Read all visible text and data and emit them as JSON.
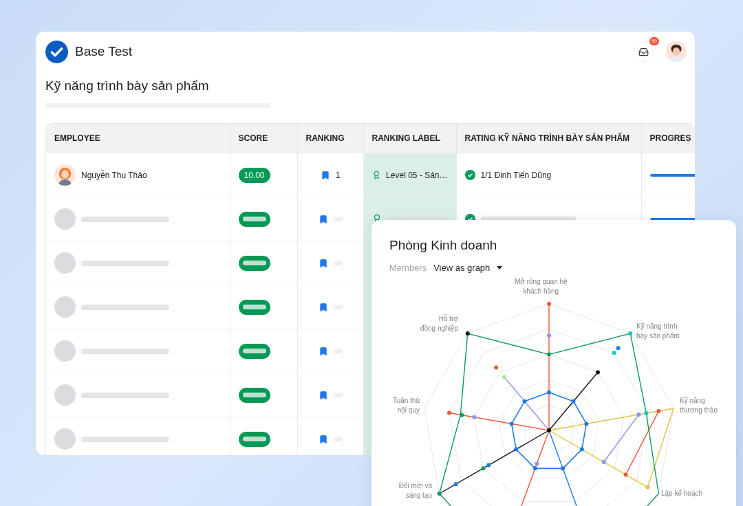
{
  "app": {
    "title": "Base Test",
    "notification_count": "99"
  },
  "page": {
    "title": "Kỹ năng trình bày sản phẩm"
  },
  "table": {
    "columns": [
      "EMPLOYEE",
      "SCORE",
      "RANKING",
      "RANKING LABEL",
      "RATING KỸ NĂNG TRÌNH BÀY SẢN PHẨM",
      "PROGRES"
    ],
    "rows": [
      {
        "kind": "employee",
        "name": "Nguyễn Thu Thảo",
        "score": "10.00",
        "rank": "1",
        "ranking_label": "Level 05 - Sán…",
        "rating": "1/1 Đinh Tiến Dũng",
        "level": 1
      },
      {
        "kind": "skeleton",
        "level": 1
      },
      {
        "kind": "skeleton_partial"
      },
      {
        "kind": "skeleton_partial"
      },
      {
        "kind": "skeleton_partial"
      },
      {
        "kind": "skeleton_partial"
      },
      {
        "kind": "skeleton_partial"
      }
    ]
  },
  "panel": {
    "title": "Phòng Kinh doanh",
    "filter_label": "Members",
    "view": "View as graph",
    "axis_labels": [
      "Mở rộng quan hệ\nkhách hàng",
      "Hỗ trợ\nđồng nghiệp",
      "Kỹ năng trình\nbày sản phẩm",
      "Tuân thủ\nnội quy",
      "Kỹ năng\nthương thảo",
      "Đổi mới và\nsáng tạo",
      "Lập kế hoạch"
    ]
  }
}
